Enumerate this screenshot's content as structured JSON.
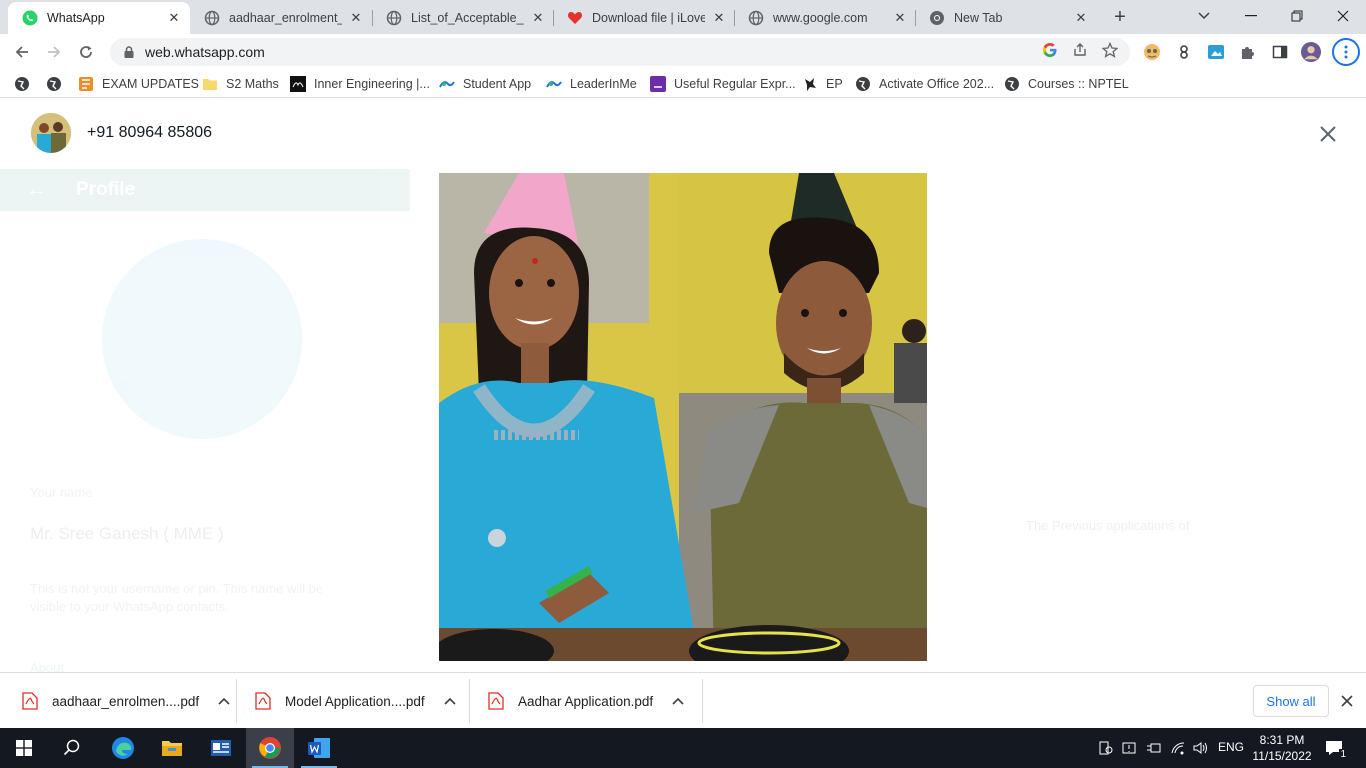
{
  "browser": {
    "tabs": [
      {
        "title": "WhatsApp",
        "favicon": "whatsapp-icon",
        "active": true
      },
      {
        "title": "aadhaar_enrolment_co",
        "favicon": "globe-icon",
        "active": false
      },
      {
        "title": "List_of_Acceptable_do",
        "favicon": "globe-icon",
        "active": false
      },
      {
        "title": "Download file | iLoveP",
        "favicon": "ilovepdf-heart-icon",
        "active": false
      },
      {
        "title": "www.google.com",
        "favicon": "globe-icon",
        "active": false
      },
      {
        "title": "New Tab",
        "favicon": "chrome-icon",
        "active": false
      }
    ],
    "url": "web.whatsapp.com",
    "bookmarks": [
      {
        "label": "",
        "icon": "globe-icon"
      },
      {
        "label": "",
        "icon": "globe-icon"
      },
      {
        "label": "EXAM UPDATES",
        "icon": "exam-app-icon"
      },
      {
        "label": "S2 Maths",
        "icon": "folder-icon"
      },
      {
        "label": "Inner Engineering |...",
        "icon": "isha-icon"
      },
      {
        "label": "Student App",
        "icon": "student-app-icon"
      },
      {
        "label": "LeaderInMe",
        "icon": "leaderinme-icon"
      },
      {
        "label": "Useful Regular Expr...",
        "icon": "regex-icon"
      },
      {
        "label": "EP",
        "icon": "ep-icon"
      },
      {
        "label": "Activate Office 202...",
        "icon": "globe-icon"
      },
      {
        "label": "Courses :: NPTEL",
        "icon": "globe-icon"
      }
    ]
  },
  "viewer": {
    "contact": "+91 80964 85806"
  },
  "background": {
    "profile_heading": "Profile",
    "your_name_label": "Your name",
    "name_value": "Mr. Sree Ganesh ( MME )",
    "name_hint": "This is not your username or pin. This name will be visible to your WhatsApp contacts.",
    "about_label": "About",
    "banner": "The Previous applications of"
  },
  "downloads": {
    "items": [
      {
        "name": "aadhaar_enrolmen....pdf"
      },
      {
        "name": "Model Application....pdf"
      },
      {
        "name": "Aadhar Application.pdf"
      }
    ],
    "show_all": "Show all"
  },
  "taskbar": {
    "lang": "ENG",
    "time": "8:31 PM",
    "date": "11/15/2022",
    "notifications": "1"
  },
  "colors": {
    "whatsapp_green": "#25d366",
    "chrome_accent": "#1a73e8",
    "taskbar_bg": "#141820",
    "photo_wall": "#d9c646",
    "dress_blue": "#29a9d6",
    "tshirt_olive": "#6b6a38"
  }
}
